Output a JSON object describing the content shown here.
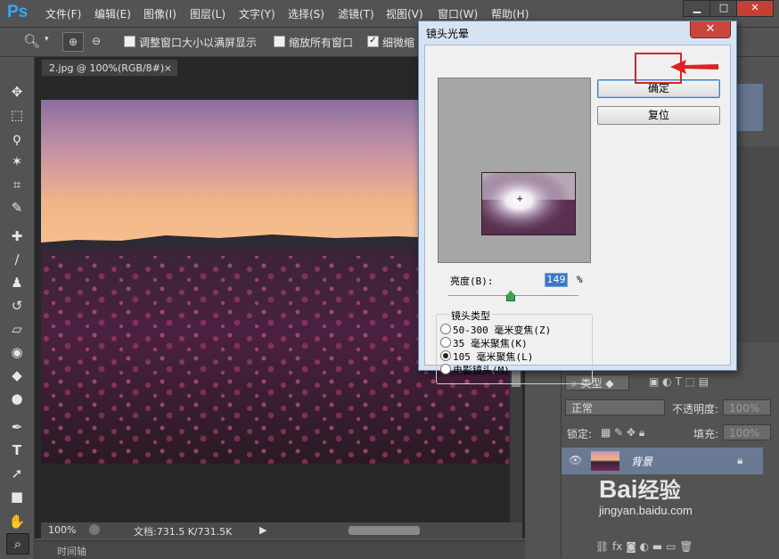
{
  "app": {
    "logo": "Ps"
  },
  "menu": [
    "文件(F)",
    "编辑(E)",
    "图像(I)",
    "图层(L)",
    "文字(Y)",
    "选择(S)",
    "滤镜(T)",
    "视图(V)",
    "窗口(W)",
    "帮助(H)"
  ],
  "window_controls": {
    "minimize": "▁",
    "maximize": "□",
    "close": "✕"
  },
  "options": {
    "resize_windows": "调整窗口大小以满屏显示",
    "zoom_all": "缩放所有窗口",
    "scrubby_zoom": "细微缩"
  },
  "document": {
    "tab_title": "2.jpg @ 100%(RGB/8#)",
    "zoom": "100%",
    "doc_size": "文档:731.5 K/731.5K"
  },
  "timeline": {
    "label": "时间轴"
  },
  "layers": {
    "filter_kind": "类型",
    "blend_mode": "正常",
    "opacity_label": "不透明度:",
    "opacity_value": "100%",
    "lock_label": "锁定:",
    "fill_label": "填充:",
    "fill_value": "100%",
    "layer_name": "背景"
  },
  "dialog": {
    "title": "镜头光晕",
    "ok": "确定",
    "reset": "复位",
    "brightness_label": "亮度(B):",
    "brightness_value": "149",
    "brightness_unit": "%",
    "brightness_level": 149,
    "lens_type_label": "镜头类型",
    "lens_options": [
      {
        "label": "50-300 毫米变焦(Z)",
        "selected": false
      },
      {
        "label": "35 毫米聚焦(K)",
        "selected": false
      },
      {
        "label": "105 毫米聚焦(L)",
        "selected": true
      },
      {
        "label": "电影镜头(M)",
        "selected": false
      }
    ]
  },
  "watermark": {
    "brand": "Bai",
    "brand2": "经验",
    "url": "jingyan.baidu.com"
  },
  "colors": {
    "accent_blue": "#31a8ff",
    "highlight_red": "#e02020",
    "dialog_frame": "#d6e3f3"
  }
}
